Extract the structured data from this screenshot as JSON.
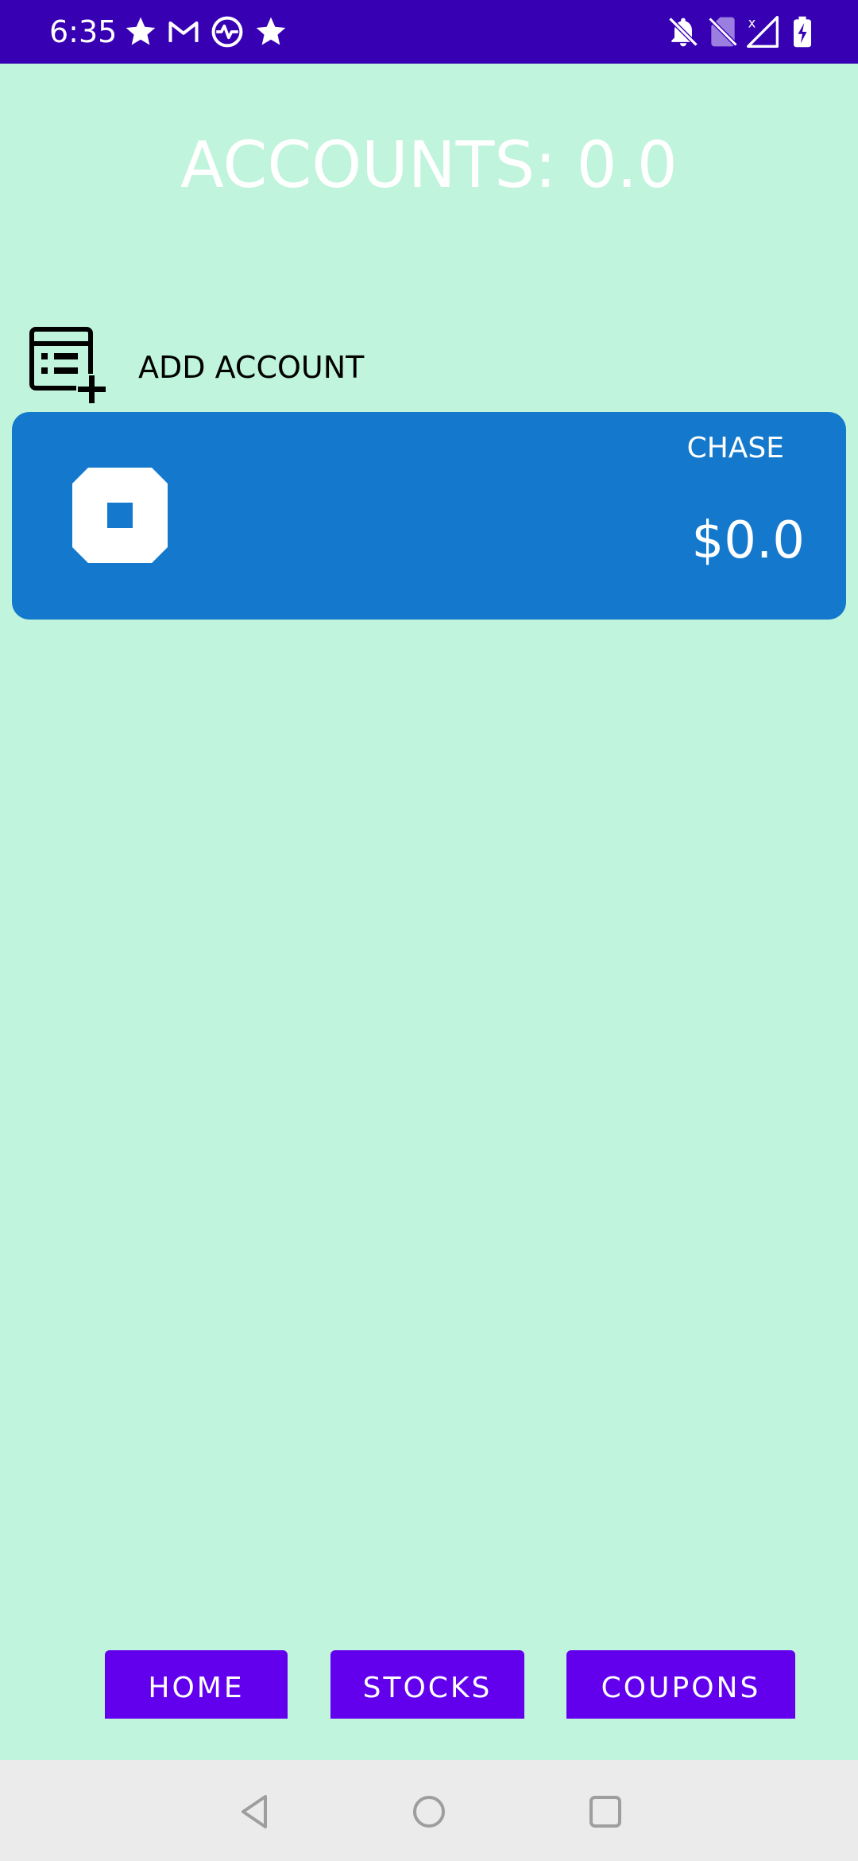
{
  "status_bar": {
    "time": "6:35",
    "background": "#3700b3",
    "left_icons": [
      "star-icon",
      "gmail-icon",
      "activity-icon",
      "star-icon"
    ],
    "right_icons": [
      "notifications-off-icon",
      "no-sim-icon",
      "signal-icon",
      "battery-charging-icon"
    ]
  },
  "main": {
    "background": "#c0f4dc",
    "title": "ACCOUNTS: 0.0",
    "add_account": {
      "label": "ADD ACCOUNT",
      "icon": "add-list-icon"
    },
    "accounts": [
      {
        "name": "CHASE",
        "balance": "$0.0",
        "logo": "chase-logo",
        "color": "#1479cc"
      }
    ]
  },
  "bottom_nav": {
    "color": "#6200ee",
    "buttons": [
      {
        "label": "HOME"
      },
      {
        "label": "STOCKS"
      },
      {
        "label": "COUPONS"
      }
    ]
  },
  "system_nav": {
    "icons": [
      "back-icon",
      "home-circle-icon",
      "recents-icon"
    ]
  }
}
